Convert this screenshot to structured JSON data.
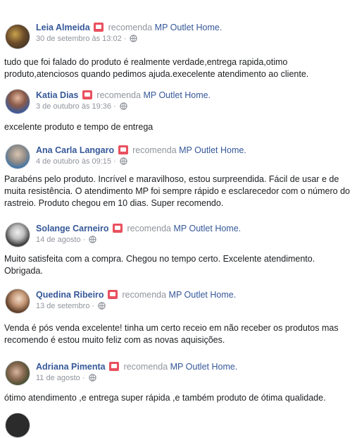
{
  "recommend_verb": "recomenda",
  "page_name": "MP Outlet Home.",
  "reviews": [
    {
      "name": "Leia Almeida",
      "date": "30 de setembro às 13:02 ·",
      "text": "tudo que foi falado do produto é realmente verdade,entrega rapida,otimo produto,atenciosos quando pedimos ajuda.execelente atendimento ao cliente."
    },
    {
      "name": "Katia Dias",
      "date": "3 de outubro às 19:36 ·",
      "text": "excelente produto e tempo de entrega"
    },
    {
      "name": "Ana Carla Langaro",
      "date": "4 de outubro às 09:15 ·",
      "text": "Parabéns pelo produto. Incrível e maravilhoso, estou surpreendida. Fácil de usar e de muita resistência. O atendimento MP foi sempre rápido e esclarecedor com o número do rastreio. Produto chegou em 10 dias. Super recomendo."
    },
    {
      "name": "Solange Carneiro",
      "date": "14 de agosto ·",
      "text": "Muito satisfeita com a compra. Chegou no tempo certo. Excelente atendimento. Obrigada."
    },
    {
      "name": "Quedina Ribeiro",
      "date": "13 de setembro ·",
      "text": "Venda é pós venda excelente! tinha um certo receio em não receber os produtos mas recomendo é estou muito feliz com as novas aquisições."
    },
    {
      "name": "Adriana Pimenta",
      "date": "11 de agosto ·",
      "text": "ótimo atendimento ,e entrega super rápida ,e também produto de ótima qualidade."
    }
  ]
}
